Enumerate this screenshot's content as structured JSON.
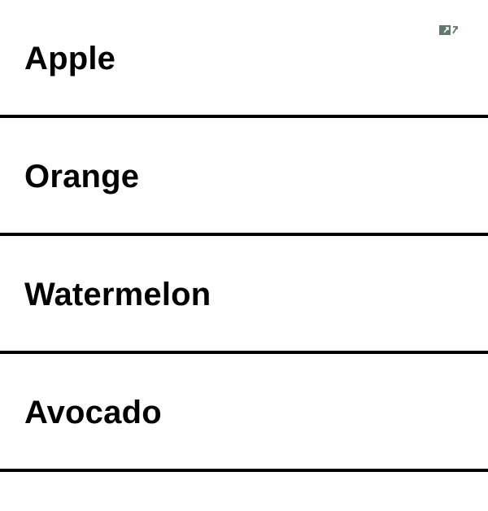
{
  "fruits": {
    "items": [
      {
        "label": "Apple"
      },
      {
        "label": "Orange"
      },
      {
        "label": "Watermelon"
      },
      {
        "label": "Avocado"
      }
    ]
  },
  "icons": {
    "corner": "expand-icon"
  },
  "colors": {
    "divider": "#000000",
    "text": "#000000",
    "icon": "#5f7a6a",
    "background": "#ffffff"
  }
}
